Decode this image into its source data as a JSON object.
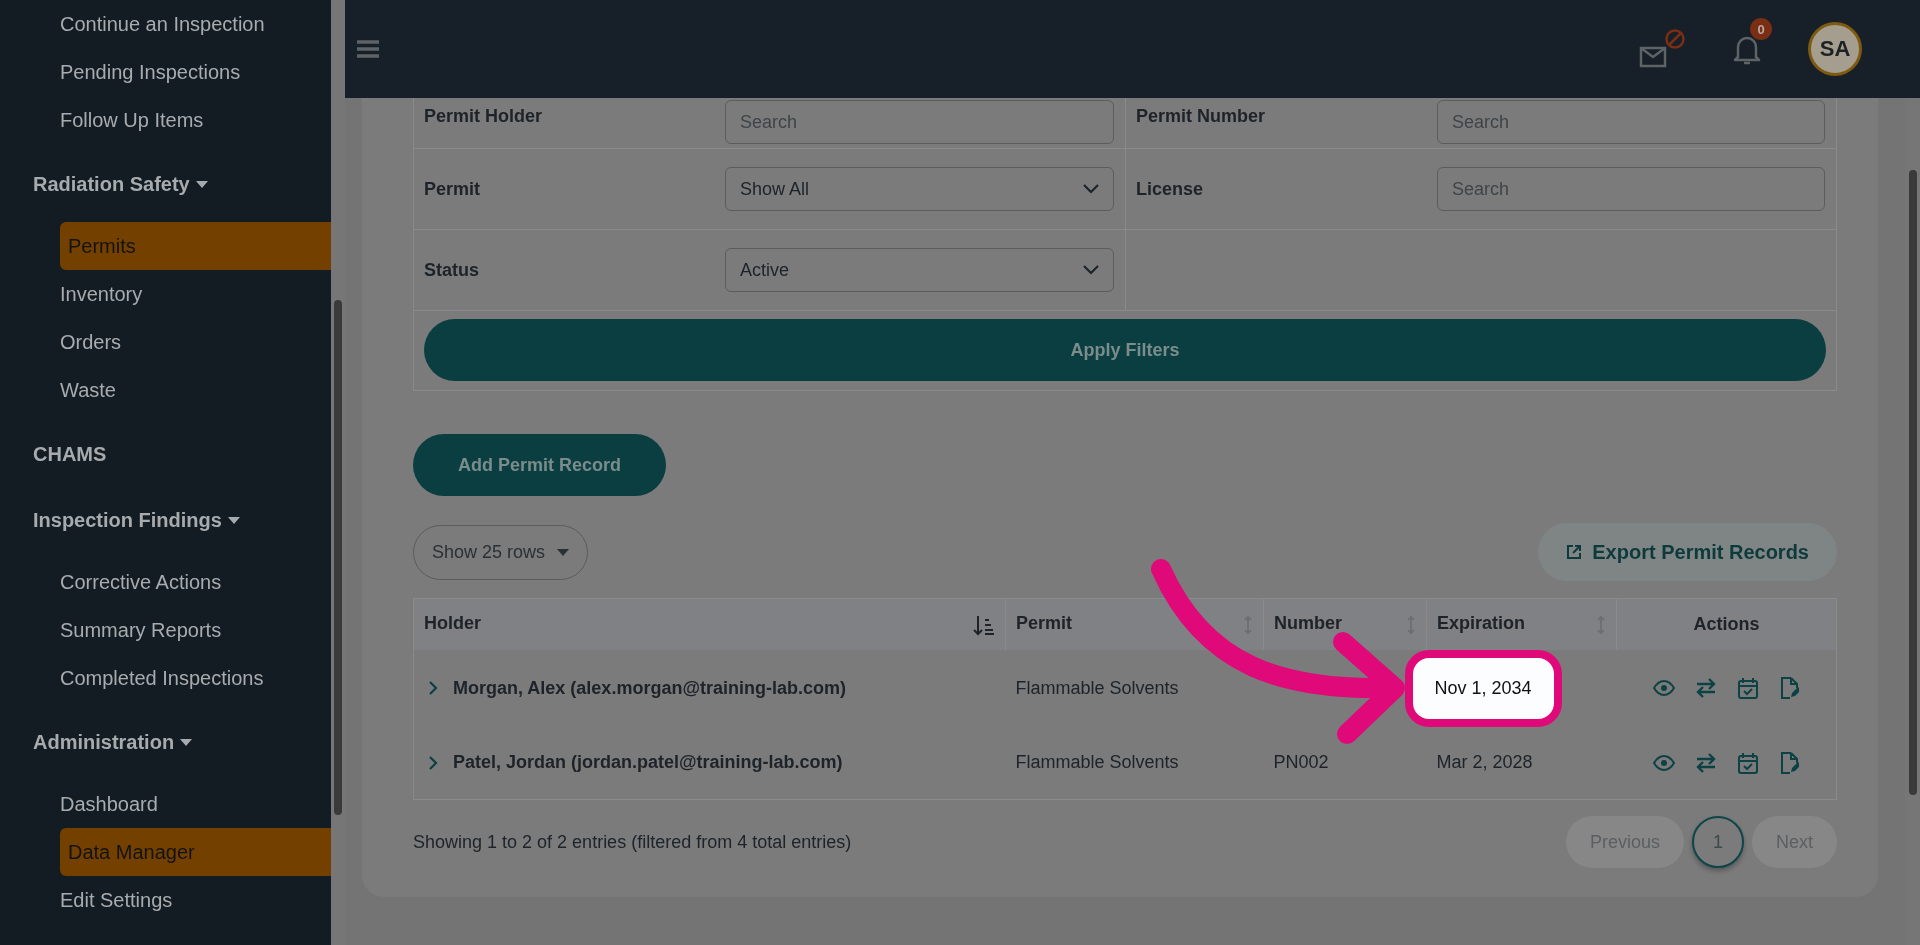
{
  "sidebar": {
    "sections": [
      {
        "kind": "group",
        "items": [
          {
            "label": "Continue an Inspection",
            "selected": false
          },
          {
            "label": "Pending Inspections",
            "selected": false
          },
          {
            "label": "Follow Up Items",
            "selected": false
          }
        ]
      },
      {
        "kind": "group",
        "title": "Radiation Safety",
        "expanded": true,
        "items": [
          {
            "label": "Permits",
            "selected": true
          },
          {
            "label": "Inventory",
            "selected": false
          },
          {
            "label": "Orders",
            "selected": false
          },
          {
            "label": "Waste",
            "selected": false
          }
        ]
      },
      {
        "kind": "link",
        "title": "CHAMS"
      },
      {
        "kind": "group",
        "title": "Inspection Findings",
        "expanded": true,
        "items": [
          {
            "label": "Corrective Actions",
            "selected": false
          },
          {
            "label": "Summary Reports",
            "selected": false
          },
          {
            "label": "Completed Inspections",
            "selected": false
          }
        ]
      },
      {
        "kind": "group",
        "title": "Administration",
        "expanded": true,
        "items": [
          {
            "label": "Dashboard",
            "selected": false
          },
          {
            "label": "Data Manager",
            "selected": true
          },
          {
            "label": "Edit Settings",
            "selected": false
          }
        ]
      }
    ]
  },
  "header": {
    "mail_blocked": true,
    "notifications": "0",
    "avatar": "SA"
  },
  "filters": {
    "rows": [
      [
        {
          "label": "Permit Holder",
          "kind": "text",
          "placeholder": "Search"
        },
        {
          "label": "Permit Number",
          "kind": "text",
          "placeholder": "Search"
        }
      ],
      [
        {
          "label": "Permit",
          "kind": "select",
          "value": "Show All"
        },
        {
          "label": "License",
          "kind": "text",
          "placeholder": "Search"
        }
      ],
      [
        {
          "label": "Status",
          "kind": "select",
          "value": "Active"
        }
      ]
    ],
    "apply": "Apply Filters"
  },
  "add_button": "Add Permit Record",
  "page_length": "Show 25 rows",
  "export_button": "Export Permit Records",
  "table": {
    "columns": [
      {
        "label": "Holder",
        "sortable": true,
        "sorted": true
      },
      {
        "label": "Permit",
        "sortable": true,
        "sorted": false
      },
      {
        "label": "Number",
        "sortable": true,
        "sorted": false
      },
      {
        "label": "Expiration",
        "sortable": true,
        "sorted": false
      },
      {
        "label": "Actions",
        "sortable": false
      }
    ],
    "rows": [
      {
        "holder": "Morgan, Alex (alex.morgan@training-lab.com)",
        "permit": "Flammable Solvents",
        "expiration": "Nov 1, 2034",
        "highlighted": true
      },
      {
        "holder": "Patel, Jordan (jordan.patel@training-lab.com)",
        "permit": "Flammable Solvents",
        "number": "PN002",
        "expiration": "Mar 2, 2028",
        "highlighted": false
      }
    ]
  },
  "footer": {
    "info": "Showing 1 to 2 of 2 entries (filtered from 4 total entries)",
    "previous": {
      "label": "Previous",
      "disabled": true
    },
    "pages": [
      {
        "label": "1",
        "selected": true
      }
    ],
    "next": {
      "label": "Next",
      "disabled": true
    }
  }
}
